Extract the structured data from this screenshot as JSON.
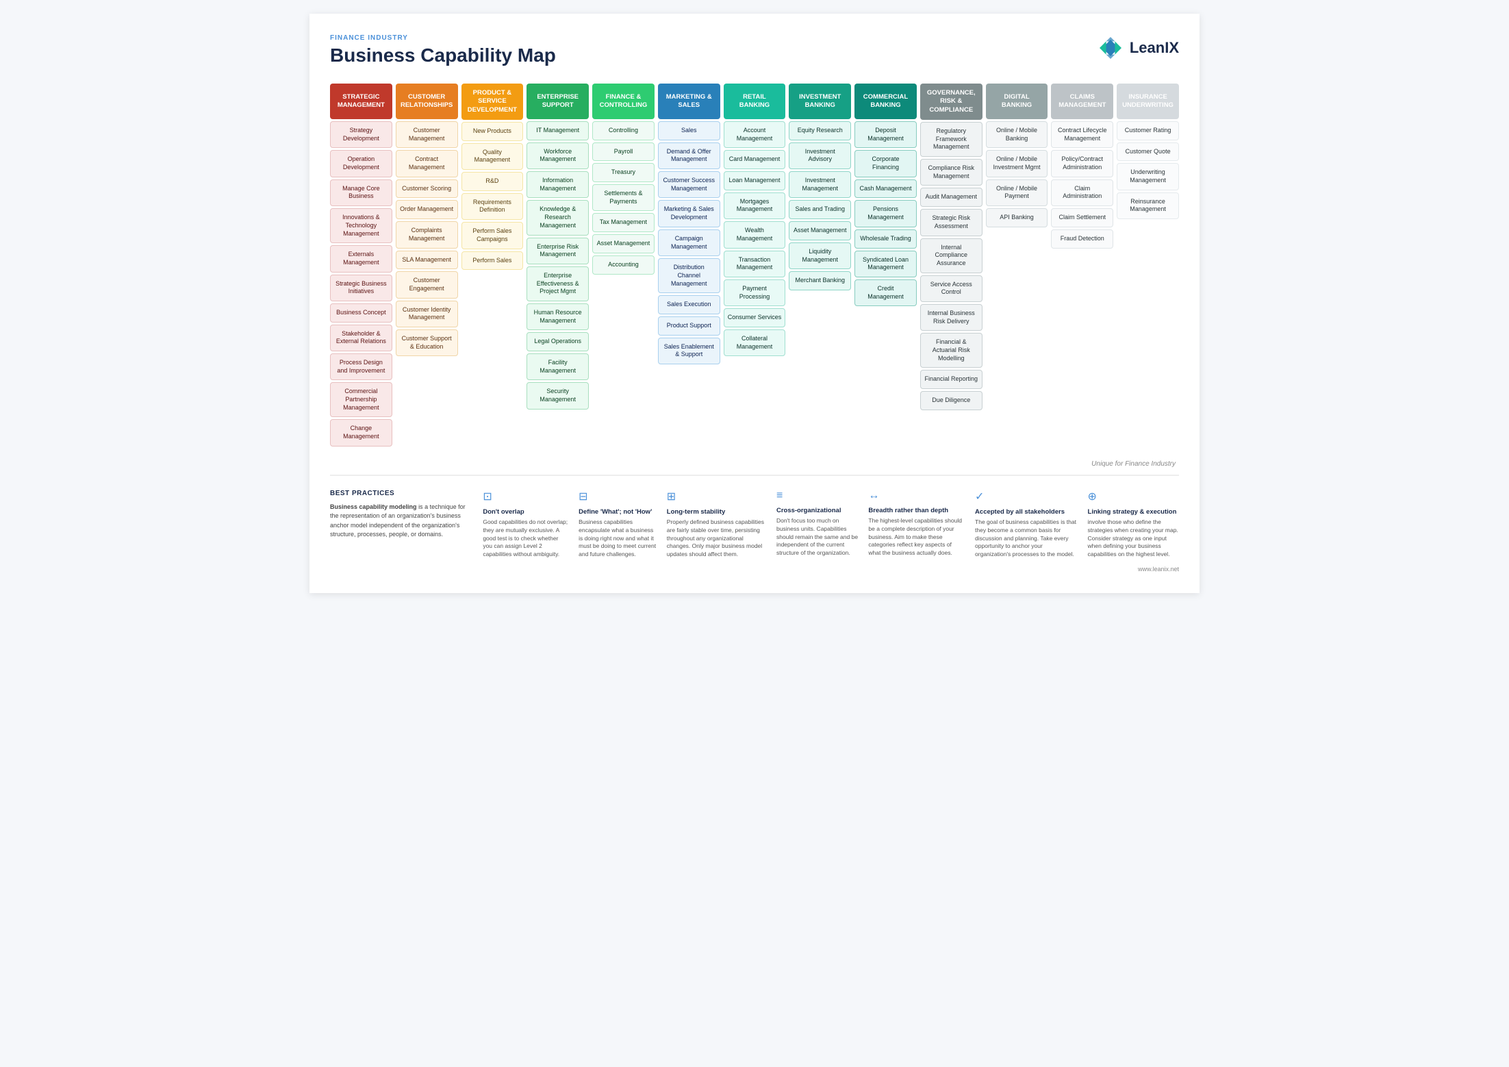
{
  "header": {
    "industry_label": "FINANCE INDUSTRY",
    "title": "Business Capability Map",
    "logo_text": "LeanIX",
    "url": "www.leanix.net"
  },
  "columns": [
    {
      "id": "strategic",
      "header": "STRATEGIC MANAGEMENT",
      "color_class": "col-strategic",
      "items": [
        "Strategy Development",
        "Operation Development",
        "Manage Core Business",
        "Innovations & Technology Management",
        "Externals Management",
        "Strategic Business Initiatives",
        "Business Concept",
        "Stakeholder & External Relations",
        "Process Design and Improvement",
        "Commercial Partnership Management",
        "Change Management"
      ]
    },
    {
      "id": "customer",
      "header": "CUSTOMER RELATIONSHIPS",
      "color_class": "col-customer",
      "items": [
        "Customer Management",
        "Contract Management",
        "Customer Scoring",
        "Order Management",
        "Complaints Management",
        "SLA Management",
        "Customer Engagement",
        "Customer Identity Management",
        "Customer Support & Education"
      ]
    },
    {
      "id": "product",
      "header": "PRODUCT & SERVICE DEVELOPMENT",
      "color_class": "col-product",
      "items": [
        "New Products",
        "Quality Management",
        "R&D",
        "Requirements Definition",
        "Perform Sales Campaigns",
        "Perform Sales"
      ]
    },
    {
      "id": "enterprise",
      "header": "ENTERPRISE SUPPORT",
      "color_class": "col-enterprise",
      "items": [
        "IT Management",
        "Workforce Management",
        "Information Management",
        "Knowledge & Research Management",
        "Enterprise Risk Management",
        "Enterprise Effectiveness & Project Mgmt",
        "Human Resource Management",
        "Legal Operations",
        "Facility Management",
        "Security Management"
      ]
    },
    {
      "id": "finance",
      "header": "FINANCE & CONTROLLING",
      "color_class": "col-finance",
      "items": [
        "Controlling",
        "Payroll",
        "Treasury",
        "Settlements & Payments",
        "Tax Management",
        "Asset Management",
        "Accounting"
      ]
    },
    {
      "id": "marketing",
      "header": "MARKETING & SALES",
      "color_class": "col-marketing",
      "items": [
        "Sales",
        "Demand & Offer Management",
        "Customer Success Management",
        "Marketing & Sales Development",
        "Campaign Management",
        "Distribution Channel Management",
        "Sales Execution",
        "Product Support",
        "Sales Enablement & Support"
      ]
    },
    {
      "id": "retail",
      "header": "RETAIL BANKING",
      "color_class": "col-retail",
      "items": [
        "Account Management",
        "Card Management",
        "Loan Management",
        "Mortgages Management",
        "Wealth Management",
        "Transaction Management",
        "Payment Processing",
        "Consumer Services",
        "Collateral Management"
      ]
    },
    {
      "id": "investment",
      "header": "INVESTMENT BANKING",
      "color_class": "col-investment",
      "items": [
        "Equity Research",
        "Investment Advisory",
        "Investment Management",
        "Sales and Trading",
        "Asset Management",
        "Liquidity Management",
        "Merchant Banking"
      ]
    },
    {
      "id": "commercial",
      "header": "COMMERCIAL BANKING",
      "color_class": "col-commercial",
      "items": [
        "Deposit Management",
        "Corporate Financing",
        "Cash Management",
        "Pensions Management",
        "Wholesale Trading",
        "Syndicated Loan Management",
        "Credit Management"
      ]
    },
    {
      "id": "governance",
      "header": "GOVERNANCE, RISK & COMPLIANCE",
      "color_class": "col-governance",
      "items": [
        "Regulatory Framework Management",
        "Compliance Risk Management",
        "Audit Management",
        "Strategic Risk Assessment",
        "Internal Compliance Assurance",
        "Service Access Control",
        "Internal Business Risk Delivery",
        "Financial & Actuarial Risk Modelling",
        "Financial Reporting",
        "Due Diligence"
      ]
    },
    {
      "id": "digital",
      "header": "DIGITAL BANKING",
      "color_class": "col-digital",
      "items": [
        "Online / Mobile Banking",
        "Online / Mobile Investment Mgmt",
        "Online / Mobile Payment",
        "API Banking"
      ]
    },
    {
      "id": "claims",
      "header": "CLAIMS MANAGEMENT",
      "color_class": "col-claims",
      "items": [
        "Contract Lifecycle Management",
        "Policy/Contract Administration",
        "Claim Administration",
        "Claim Settlement",
        "Fraud Detection"
      ]
    },
    {
      "id": "insurance",
      "header": "INSURANCE UNDERWRITING",
      "color_class": "col-insurance",
      "items": [
        "Customer Rating",
        "Customer Quote",
        "Underwriting Management",
        "Reinsurance Management"
      ]
    }
  ],
  "unique_label": "Unique for Finance Industry",
  "best_practices": {
    "label": "BEST PRACTICES",
    "intro_title": "Business capability modeling",
    "intro_text": "is a technique for the representation of an organization's business anchor model independent of the organization's structure, processes, people, or domains.",
    "items": [
      {
        "icon": "⊡",
        "title": "Don't overlap",
        "text": "Good capabilities do not overlap; they are mutually exclusive. A good test is to check whether you can assign Level 2 capabilities without ambiguity."
      },
      {
        "icon": "⊟",
        "title": "Define 'What'; not 'How'",
        "text": "Business capabilities encapsulate what a business is doing right now and what it must be doing to meet current and future challenges."
      },
      {
        "icon": "⊞",
        "title": "Long-term stability",
        "text": "Properly defined business capabilities are fairly stable over time, persisting throughout any organizational changes. Only major business model updates should affect them."
      },
      {
        "icon": "≡",
        "title": "Cross-organizational",
        "text": "Don't focus too much on business units. Capabilities should remain the same and be independent of the current structure of the organization."
      },
      {
        "icon": "↔",
        "title": "Breadth rather than depth",
        "text": "The highest-level capabilities should be a complete description of your business. Aim to make these categories reflect key aspects of what the business actually does."
      },
      {
        "icon": "✓",
        "title": "Accepted by all stakeholders",
        "text": "The goal of business capabilities is that they become a common basis for discussion and planning. Take every opportunity to anchor your organization's processes to the model."
      },
      {
        "icon": "⊕",
        "title": "Linking strategy & execution",
        "text": "involve those who define the strategies when creating your map. Consider strategy as one input when defining your business capabilities on the highest level."
      }
    ]
  },
  "footer_url": "www.leanix.net"
}
